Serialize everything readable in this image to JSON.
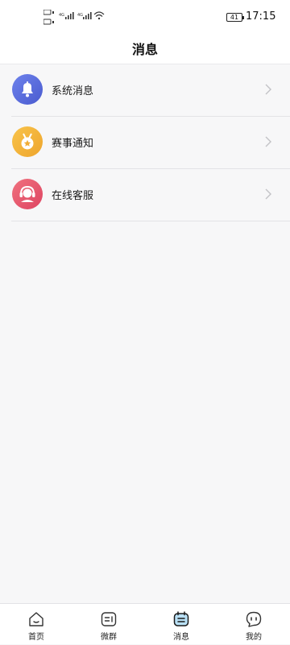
{
  "status_bar": {
    "network_1": "4G",
    "network_2": "4G",
    "battery": "41",
    "time": "17:15"
  },
  "header": {
    "title": "消息"
  },
  "list": {
    "items": [
      {
        "label": "系统消息",
        "icon": "bell-icon",
        "color": "#5b6fd8"
      },
      {
        "label": "赛事通知",
        "icon": "medal-icon",
        "color": "#f3b43a"
      },
      {
        "label": "在线客服",
        "icon": "headset-icon",
        "color": "#e8566f"
      }
    ]
  },
  "tabbar": {
    "tabs": [
      {
        "label": "首页",
        "icon": "home-icon"
      },
      {
        "label": "微群",
        "icon": "chat-group-icon"
      },
      {
        "label": "消息",
        "icon": "message-icon",
        "active": true
      },
      {
        "label": "我的",
        "icon": "profile-icon"
      }
    ],
    "active_color": "#1a1a1a"
  }
}
